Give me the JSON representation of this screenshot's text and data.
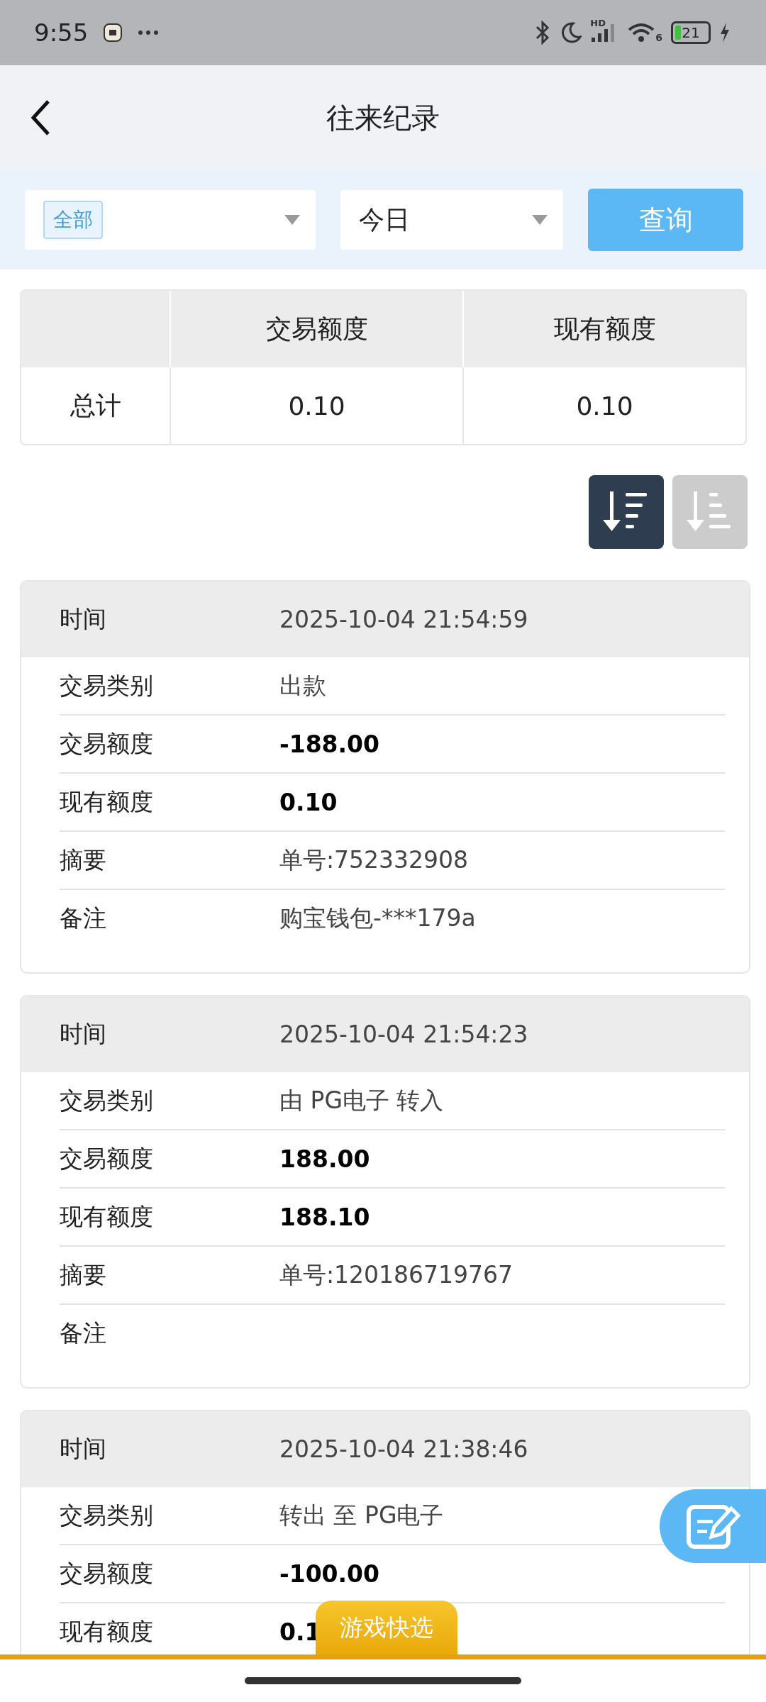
{
  "status_bar": {
    "time": "9:55",
    "network_label": "HD",
    "wifi_label": "6",
    "battery": "21"
  },
  "header": {
    "title": "往来纪录"
  },
  "filters": {
    "type_select": {
      "tag": "全部"
    },
    "date_select": {
      "value": "今日"
    },
    "query_button": "查询"
  },
  "summary": {
    "columns": [
      "交易额度",
      "现有额度"
    ],
    "row": {
      "label": "总计",
      "values": [
        "0.10",
        "0.10"
      ]
    }
  },
  "sort_buttons": [
    {
      "kind": "desc",
      "selected": true
    },
    {
      "kind": "asc",
      "selected": false
    }
  ],
  "records": [
    {
      "time_label": "时间",
      "time": "2025-10-04 21:54:59",
      "rows": [
        {
          "label": "交易类别",
          "value": "出款",
          "bold": false
        },
        {
          "label": "交易额度",
          "value": "-188.00",
          "bold": true
        },
        {
          "label": "现有额度",
          "value": "0.10",
          "bold": true
        },
        {
          "label": "摘要",
          "value": "单号:752332908",
          "bold": false
        },
        {
          "label": "备注",
          "value": "购宝钱包-***179a",
          "bold": false
        }
      ]
    },
    {
      "time_label": "时间",
      "time": "2025-10-04 21:54:23",
      "rows": [
        {
          "label": "交易类别",
          "value": "由 PG电子 转入",
          "bold": false
        },
        {
          "label": "交易额度",
          "value": "188.00",
          "bold": true
        },
        {
          "label": "现有额度",
          "value": "188.10",
          "bold": true
        },
        {
          "label": "摘要",
          "value": "单号:120186719767",
          "bold": false
        },
        {
          "label": "备注"
        }
      ]
    },
    {
      "time_label": "时间",
      "time": "2025-10-04 21:38:46",
      "rows": [
        {
          "label": "交易类别",
          "value": "转出 至 PG电子",
          "bold": false
        },
        {
          "label": "交易额度",
          "value": "-100.00",
          "bold": true
        },
        {
          "label": "现有额度",
          "value": "0.1",
          "bold": true
        }
      ]
    }
  ],
  "quick_tab": "游戏快选"
}
